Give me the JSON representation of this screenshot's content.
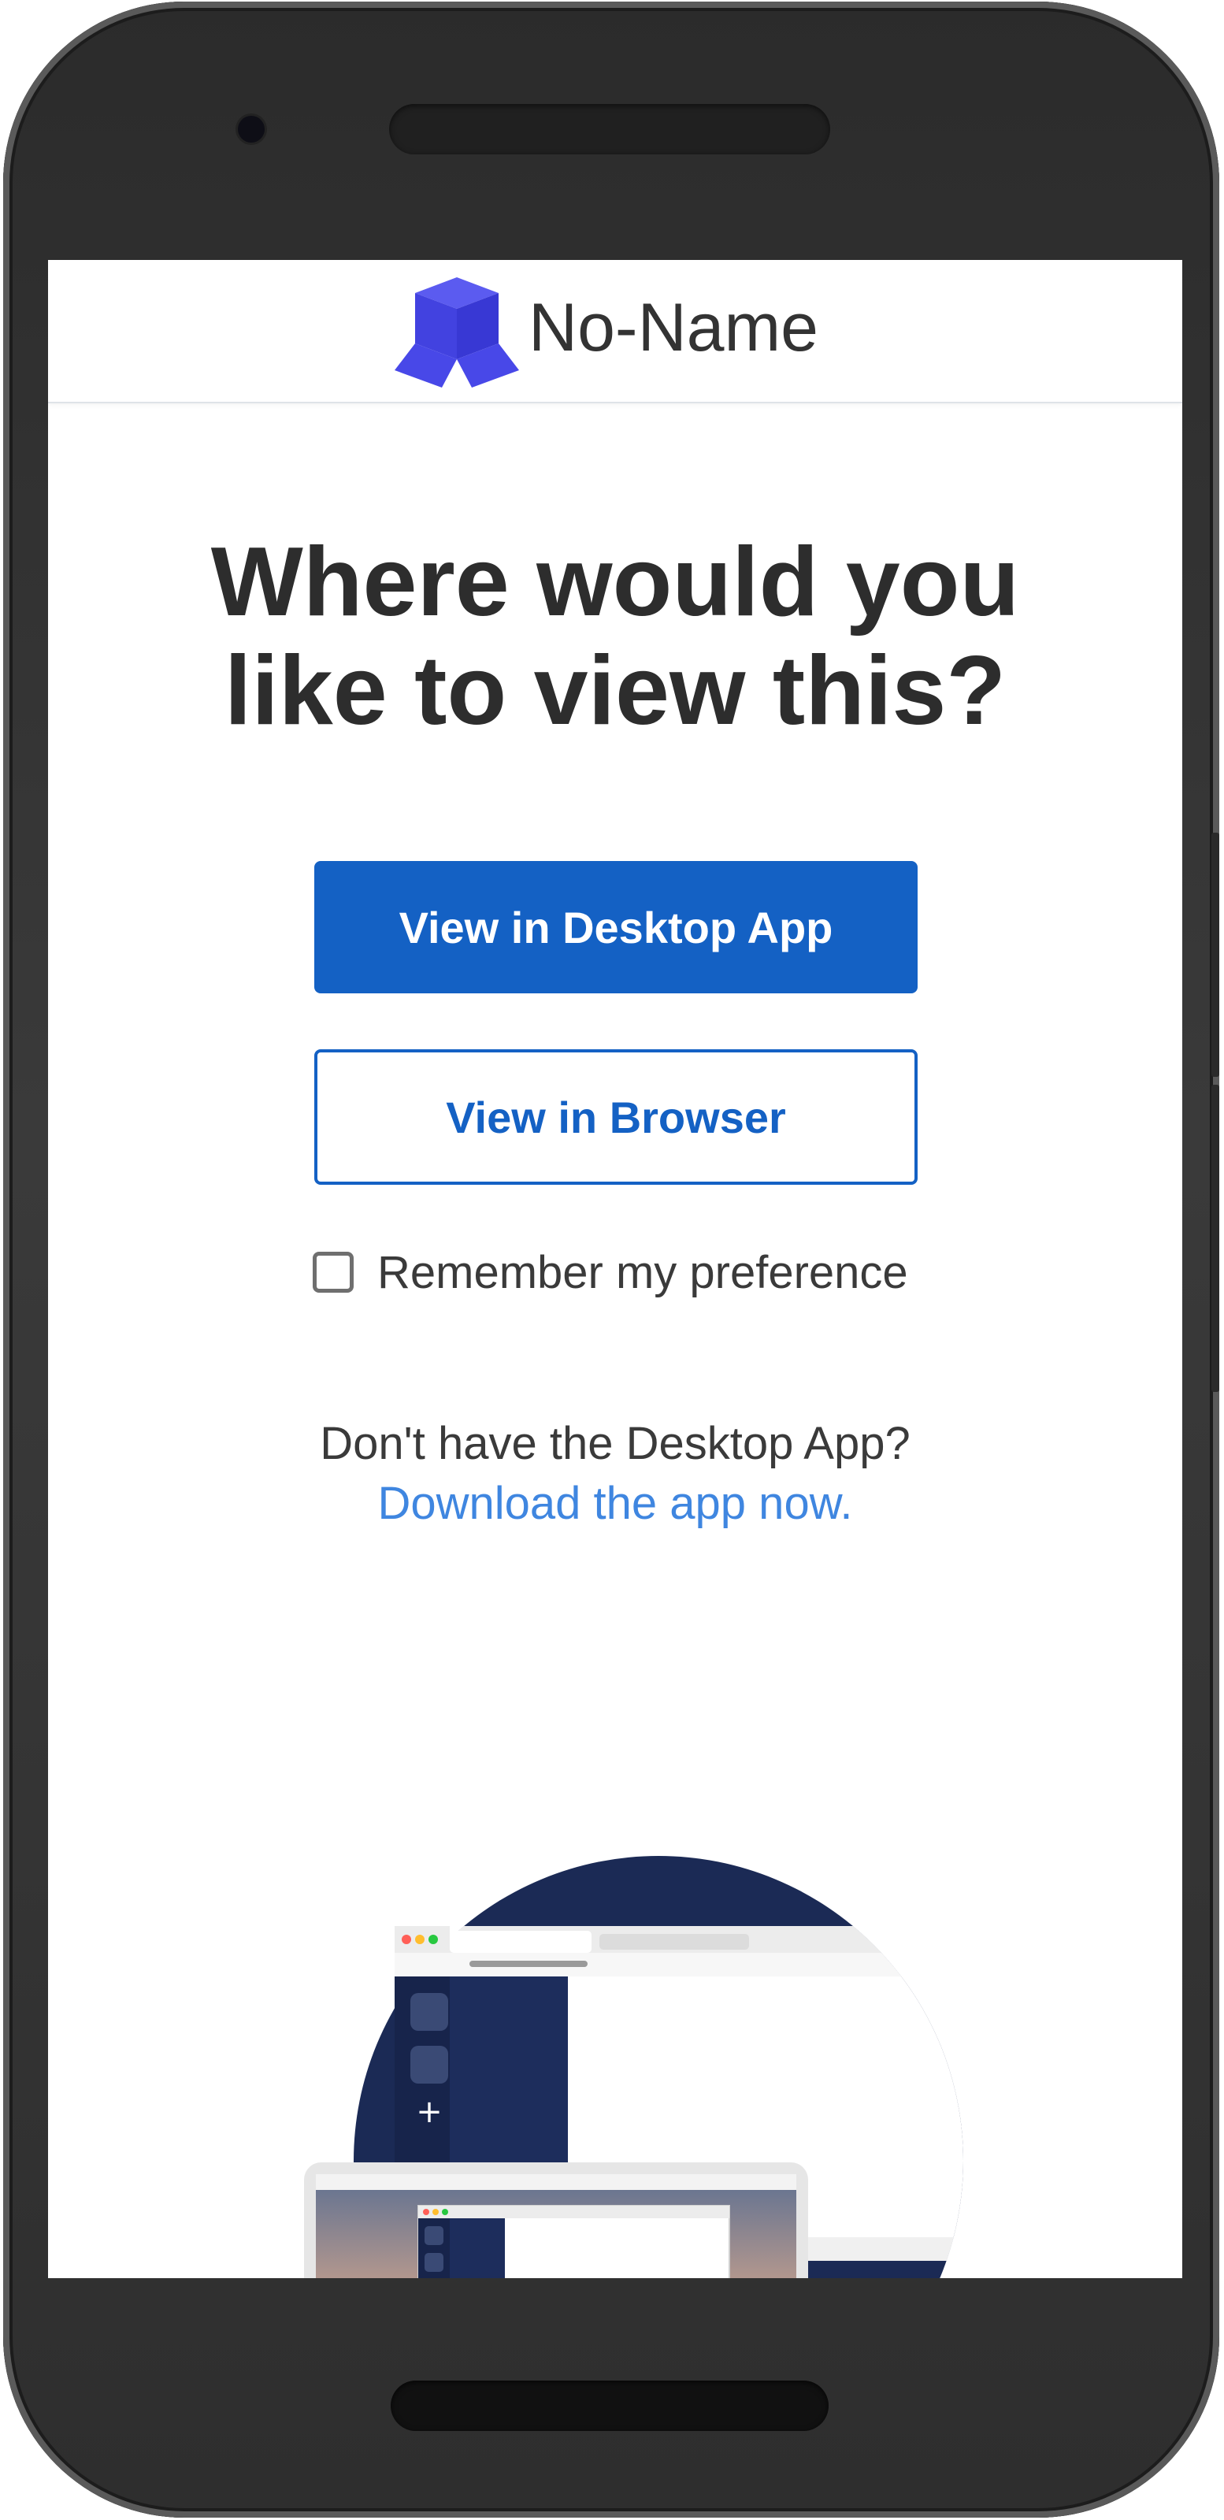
{
  "app": {
    "name": "No-Name",
    "logo_icon": "cube-logo-icon",
    "brand_color": "#4848e8"
  },
  "page": {
    "headline_line1": "Where would you",
    "headline_line2": "like to view this?",
    "primary_button_label": "View in Desktop App",
    "secondary_button_label": "View in Browser",
    "remember_label": "Remember my preference",
    "remember_checked": false,
    "no_app_text": "Don't have the Desktop App?",
    "download_link_text": "Download the app now."
  },
  "colors": {
    "primary": "#1461c4",
    "link": "#3f86e0",
    "text": "#2d2d2d",
    "illustration_navy": "#1b2a55"
  }
}
